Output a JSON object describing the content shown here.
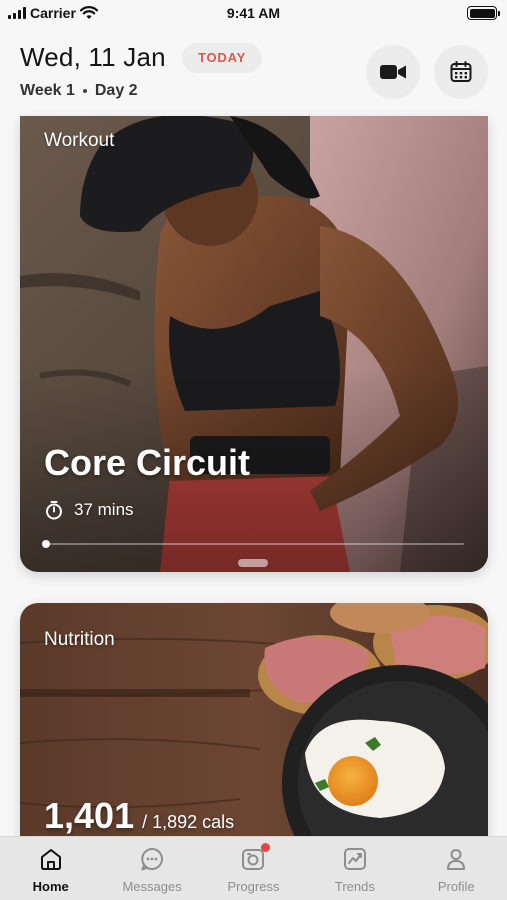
{
  "status_bar": {
    "carrier": "Carrier",
    "time": "9:41 AM"
  },
  "header": {
    "date": "Wed, 11 Jan",
    "today_badge": "TODAY",
    "week": "Week 1",
    "day": "Day 2"
  },
  "workout": {
    "label": "Workout",
    "title": "Core Circuit",
    "duration": "37 mins",
    "progress": 0.0
  },
  "nutrition": {
    "label": "Nutrition",
    "calories_consumed": "1,401",
    "calories_goal": "/ 1,892 cals"
  },
  "tabs": [
    {
      "label": "Home",
      "icon": "home-icon",
      "active": true
    },
    {
      "label": "Messages",
      "icon": "chat-icon",
      "active": false
    },
    {
      "label": "Progress",
      "icon": "camera-icon",
      "active": false,
      "notification": true
    },
    {
      "label": "Trends",
      "icon": "trends-icon",
      "active": false
    },
    {
      "label": "Profile",
      "icon": "profile-icon",
      "active": false
    }
  ],
  "colors": {
    "accent": "#e0554f",
    "notification": "#e64545",
    "tab_bar": "#e6e6e6"
  }
}
